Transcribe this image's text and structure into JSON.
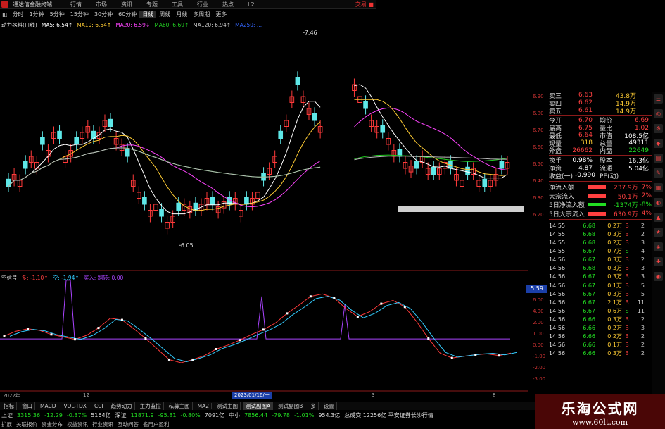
{
  "window": {
    "title": "通达信金融终端",
    "menu": [
      "行情",
      "市场",
      "资讯",
      "专题",
      "工具",
      "行业",
      "热点",
      "L2"
    ],
    "right_label": "交易 ■"
  },
  "periods": [
    {
      "label": "分时",
      "selected": false
    },
    {
      "label": "1分钟",
      "selected": false
    },
    {
      "label": "5分钟",
      "selected": false
    },
    {
      "label": "15分钟",
      "selected": false
    },
    {
      "label": "30分钟",
      "selected": false
    },
    {
      "label": "60分钟",
      "selected": false
    },
    {
      "label": "日线",
      "selected": true
    },
    {
      "label": "周线",
      "selected": false
    },
    {
      "label": "月线",
      "selected": false
    },
    {
      "label": "多周期",
      "selected": false
    },
    {
      "label": "更多",
      "selected": false
    }
  ],
  "main_legend": {
    "name": "动力器料(日线)",
    "items": [
      {
        "text": "MA5: 6.54↑",
        "color": "#ffffff"
      },
      {
        "text": "MA10: 6.54↑",
        "color": "#ffcc33"
      },
      {
        "text": "MA20: 6.59↓",
        "color": "#ff44ff"
      },
      {
        "text": "MA60: 6.69↑",
        "color": "#22cc22"
      },
      {
        "text": "MA120: 6.94↑",
        "color": "#cccccc"
      },
      {
        "text": "MA250: ...",
        "color": "#3366ff"
      }
    ]
  },
  "price_annotations": {
    "high": "7.46",
    "low": "6.05"
  },
  "price_axis": [
    "6.90",
    "6.80",
    "6.70",
    "6.60",
    "6.50",
    "6.40",
    "6.30",
    "6.20"
  ],
  "sub_legend": {
    "name": "空信号",
    "items": [
      {
        "text": "多: -1.10↑",
        "color": "#ff4040"
      },
      {
        "text": "空: -1.94↑",
        "color": "#33ccff"
      },
      {
        "text": "买入: 翻转: 0.00",
        "color": "#aa44ff"
      }
    ]
  },
  "sub_axis": {
    "current": "5.59",
    "ticks": [
      "6.00",
      "4.00",
      "2.00",
      "1.00",
      "0.00",
      "-1.00",
      "-2.00",
      "-3.00"
    ]
  },
  "quote": {
    "depth": [
      {
        "label": "卖三",
        "price": "6.63",
        "vol": "43.8万"
      },
      {
        "label": "卖四",
        "price": "6.62",
        "vol": "14.9万"
      },
      {
        "label": "卖五",
        "price": "6.61",
        "vol": "14.9万"
      }
    ],
    "stats": [
      {
        "l1": "今开",
        "v1": "6.70",
        "l2": "均价",
        "v2": "6.69"
      },
      {
        "l1": "最高",
        "v1": "6.75",
        "l2": "量比",
        "v2": "1.02"
      },
      {
        "l1": "最低",
        "v1": "6.64",
        "l2": "市值",
        "v2": "108.5亿"
      },
      {
        "l1": "现量",
        "v1": "318",
        "l2": "总量",
        "v2": "49311"
      },
      {
        "l1": "外盘",
        "v1": "26662",
        "l2": "内盘",
        "v2": "22649"
      }
    ],
    "stats2": [
      {
        "l1": "换手",
        "v1": "0.98%",
        "l2": "股本",
        "v2": "16.3亿"
      },
      {
        "l1": "净资",
        "v1": "4.87",
        "l2": "流通",
        "v2": "5.04亿"
      },
      {
        "l1": "收益(一)",
        "v1": "-0.990",
        "l2": "PE(动)",
        "v2": ""
      }
    ],
    "flows": [
      {
        "label": "净流入额",
        "value": "237.9万",
        "pct": "7%",
        "color": "#ff4040"
      },
      {
        "label": "大宗流入",
        "value": "50.1万",
        "pct": "2%",
        "color": "#ff4040"
      },
      {
        "label": "5日净流入额",
        "value": "-1374万",
        "pct": "-8%",
        "color": "#22dd22"
      },
      {
        "label": "5日大宗流入",
        "value": "630.9万",
        "pct": "4%",
        "color": "#ff4040"
      }
    ],
    "ticks": [
      {
        "t": "14:55",
        "p": "6.68",
        "v": "0.2万",
        "s": "B",
        "c": "2"
      },
      {
        "t": "14:55",
        "p": "6.68",
        "v": "0.3万",
        "s": "B",
        "c": "2"
      },
      {
        "t": "14:55",
        "p": "6.68",
        "v": "0.2万",
        "s": "B",
        "c": "3"
      },
      {
        "t": "14:55",
        "p": "6.67",
        "v": "0.7万",
        "s": "S",
        "c": "4"
      },
      {
        "t": "14:56",
        "p": "6.67",
        "v": "0.3万",
        "s": "B",
        "c": "2"
      },
      {
        "t": "14:56",
        "p": "6.68",
        "v": "0.3万",
        "s": "B",
        "c": "3"
      },
      {
        "t": "14:56",
        "p": "6.67",
        "v": "0.3万",
        "s": "B",
        "c": "3"
      },
      {
        "t": "14:56",
        "p": "6.67",
        "v": "0.1万",
        "s": "B",
        "c": "5"
      },
      {
        "t": "14:56",
        "p": "6.67",
        "v": "0.3万",
        "s": "B",
        "c": "5"
      },
      {
        "t": "14:56",
        "p": "6.67",
        "v": "2.1万",
        "s": "B",
        "c": "11"
      },
      {
        "t": "14:56",
        "p": "6.67",
        "v": "0.6万",
        "s": "S",
        "c": "11"
      },
      {
        "t": "14:56",
        "p": "6.66",
        "v": "0.3万",
        "s": "B",
        "c": "2"
      },
      {
        "t": "14:56",
        "p": "6.66",
        "v": "0.2万",
        "s": "B",
        "c": "3"
      },
      {
        "t": "14:56",
        "p": "6.66",
        "v": "0.2万",
        "s": "B",
        "c": "2"
      },
      {
        "t": "14:56",
        "p": "6.66",
        "v": "0.1万",
        "s": "B",
        "c": "2"
      },
      {
        "t": "14:56",
        "p": "6.66",
        "v": "0.3万",
        "s": "B",
        "c": "2"
      }
    ]
  },
  "date_axis": {
    "start": "2022年",
    "mid1": "12",
    "cursor": "2023/01/16/一",
    "mid2": "3",
    "end": "8"
  },
  "tabs": [
    {
      "label": "指标",
      "selected": false
    },
    {
      "label": "窗口",
      "selected": false
    },
    {
      "label": "MACD",
      "selected": false
    },
    {
      "label": "VOL-TDX",
      "selected": false
    },
    {
      "label": "CCI",
      "selected": false
    },
    {
      "label": "趋势动力",
      "selected": false
    },
    {
      "label": "主力监控",
      "selected": false
    },
    {
      "label": "私募主图",
      "selected": false
    },
    {
      "label": "MA2",
      "selected": false
    },
    {
      "label": "测试主图",
      "selected": false
    },
    {
      "label": "测试副图A",
      "selected": true
    },
    {
      "label": "测试副图B",
      "selected": false
    },
    {
      "label": "多",
      "selected": false
    },
    {
      "label": "设置",
      "selected": false
    }
  ],
  "tabs2": [
    "扩展",
    "关联报价",
    "资金分布",
    "权益资讯",
    "行业资讯",
    "互动问答",
    "雀用户盈利"
  ],
  "status": [
    {
      "name": "上证",
      "value": "3315.36",
      "chg": "-12.29",
      "pct": "-0.37%",
      "amt": "5164亿"
    },
    {
      "name": "深证",
      "value": "11871.9",
      "chg": "-95.81",
      "pct": "-0.80%",
      "amt": "7091亿"
    },
    {
      "name": "中小",
      "value": "7856.44",
      "chg": "-79.78",
      "pct": "-1.01%",
      "amt": "954.3亿"
    }
  ],
  "status_extra": "总成交 12256亿 平安证券长沙行情",
  "watermark": {
    "line1": "乐淘公式网",
    "line2": "www.60lt.com"
  }
}
